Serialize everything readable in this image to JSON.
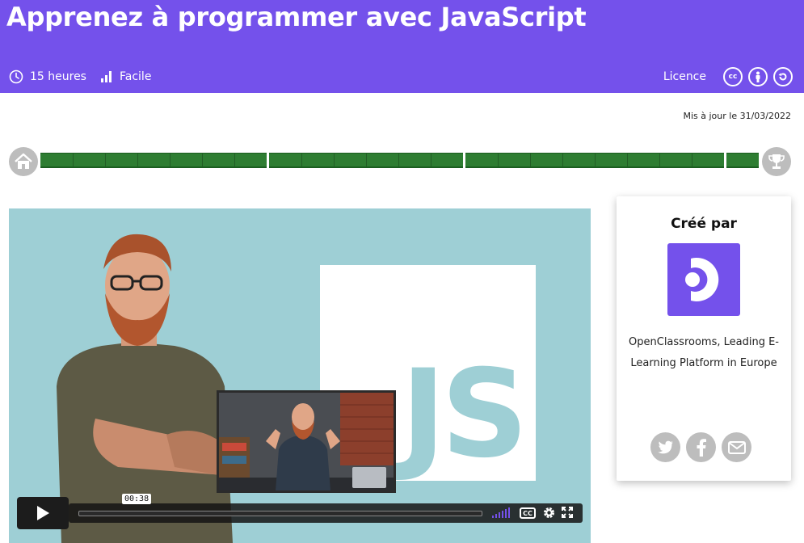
{
  "header": {
    "title": "Apprenez à programmer avec JavaScript",
    "duration": "15 heures",
    "level": "Facile",
    "license_label": "Licence",
    "license_icons": [
      "cc-icon",
      "by-icon",
      "sa-icon"
    ]
  },
  "updated": "Mis à jour le 31/03/2022",
  "progress": {
    "start_icon": "home-icon",
    "end_icon": "trophy-icon",
    "segments": [
      7,
      6,
      8,
      1
    ],
    "completed_fraction": 1.0
  },
  "video": {
    "current_time": "00:38",
    "play_icon": "play-icon",
    "thumbnail_text": "JS"
  },
  "creator": {
    "title": "Créé par",
    "name": "OpenClassrooms, Leading E-Learning Platform in Europe",
    "share_icons": [
      "twitter-icon",
      "facebook-icon",
      "mail-icon"
    ]
  },
  "colors": {
    "brand": "#7451eb",
    "progress": "#2e7d32",
    "video_bg": "#9ecfd5"
  }
}
